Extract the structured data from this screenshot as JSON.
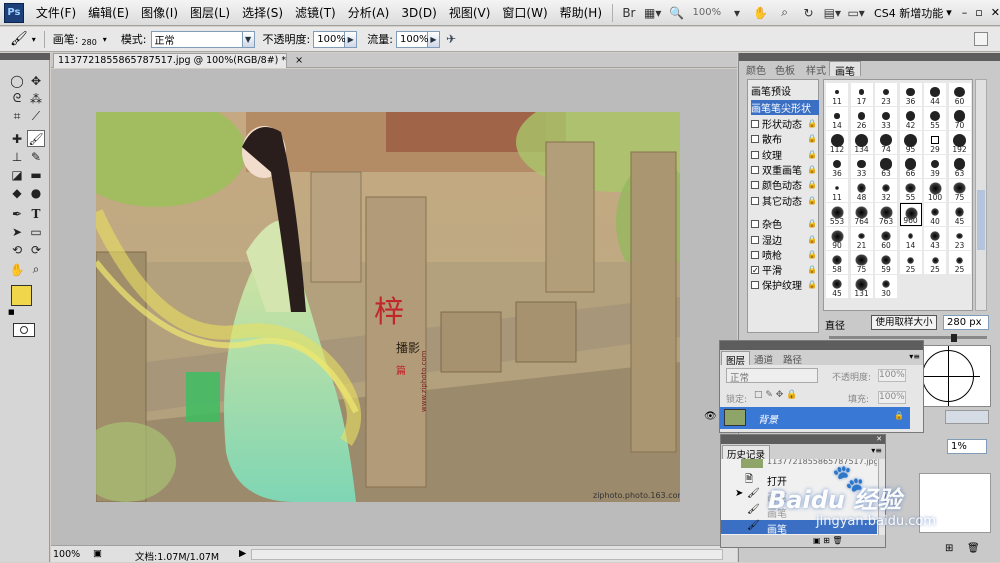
{
  "app": {
    "logo": "Ps"
  },
  "menu": [
    "文件(F)",
    "编辑(E)",
    "图像(I)",
    "图层(L)",
    "选择(S)",
    "滤镜(T)",
    "分析(A)",
    "3D(D)",
    "视图(V)",
    "窗口(W)",
    "帮助(H)"
  ],
  "menubar_right": {
    "zoom": "100%",
    "workspace": "CS4 新增功能"
  },
  "options": {
    "brush_label": "画笔:",
    "brush_size": "280",
    "mode_label": "模式:",
    "mode_value": "正常",
    "opacity_label": "不透明度:",
    "opacity_value": "100%",
    "flow_label": "流量:",
    "flow_value": "100%"
  },
  "document": {
    "tab_title": "1137721855865787517.jpg @ 100%(RGB/8#) *",
    "close": "×"
  },
  "photo": {
    "seal_big": "梓",
    "seal_line": "播影",
    "seal_small": "篇",
    "watermark": "ziphoto.photo.163.com",
    "url_side": "www.ziphoto.com"
  },
  "status": {
    "zoom": "100%",
    "doc_info": "文档:1.07M/1.07M"
  },
  "panel_tabs": [
    "颜色",
    "色板",
    "样式",
    "画笔"
  ],
  "brush_options": {
    "preset": "画笔预设",
    "items": [
      {
        "label": "画笔笔尖形状",
        "checked": false,
        "lock": false,
        "active": true
      },
      {
        "label": "形状动态",
        "checked": false,
        "lock": true
      },
      {
        "label": "散布",
        "checked": false,
        "lock": true
      },
      {
        "label": "纹理",
        "checked": false,
        "lock": true
      },
      {
        "label": "双重画笔",
        "checked": false,
        "lock": true
      },
      {
        "label": "颜色动态",
        "checked": false,
        "lock": true
      },
      {
        "label": "其它动态",
        "checked": false,
        "lock": true
      },
      {
        "label": "杂色",
        "checked": false,
        "lock": true
      },
      {
        "label": "湿边",
        "checked": false,
        "lock": true
      },
      {
        "label": "喷枪",
        "checked": false,
        "lock": true
      },
      {
        "label": "平滑",
        "checked": true,
        "lock": true
      },
      {
        "label": "保护纹理",
        "checked": false,
        "lock": true
      }
    ]
  },
  "brush_sizes": [
    [
      "11",
      "17",
      "23",
      "36",
      "44",
      "60"
    ],
    [
      "14",
      "26",
      "33",
      "42",
      "55",
      "70"
    ],
    [
      "112",
      "134",
      "74",
      "95",
      "29",
      "192"
    ],
    [
      "36",
      "33",
      "63",
      "66",
      "39",
      "63"
    ],
    [
      "11",
      "48",
      "32",
      "55",
      "100",
      "75"
    ],
    [
      "553",
      "764",
      "763",
      "960",
      "40",
      "45"
    ],
    [
      "90",
      "21",
      "60",
      "14",
      "43",
      "23"
    ],
    [
      "58",
      "75",
      "59",
      "25",
      "25",
      "25"
    ],
    [
      "45",
      "131",
      "30"
    ]
  ],
  "diameter": {
    "label": "直径",
    "button": "使用取样大小",
    "value": "280 px"
  },
  "layers": {
    "tabs": [
      "图层",
      "通道",
      "路径"
    ],
    "mode": "正常",
    "opacity_label": "不透明度:",
    "opacity": "100%",
    "lock_label": "锁定:",
    "fill_label": "填充:",
    "fill": "100%",
    "layer_name": "背景"
  },
  "spacing": {
    "value": "1%"
  },
  "history": {
    "title": "历史记录",
    "snapshot": "1137721855865787517.jpg",
    "items": [
      "打开",
      "画笔",
      "画笔",
      "画笔"
    ]
  },
  "baidu": {
    "logo": "Baidu 经验",
    "url": "jingyan.baidu.com"
  },
  "colors": {
    "foreground": "#f0d64a",
    "background": "#ffffff",
    "selection": "#3a6fc4",
    "layer_row": "#3a78d6"
  }
}
